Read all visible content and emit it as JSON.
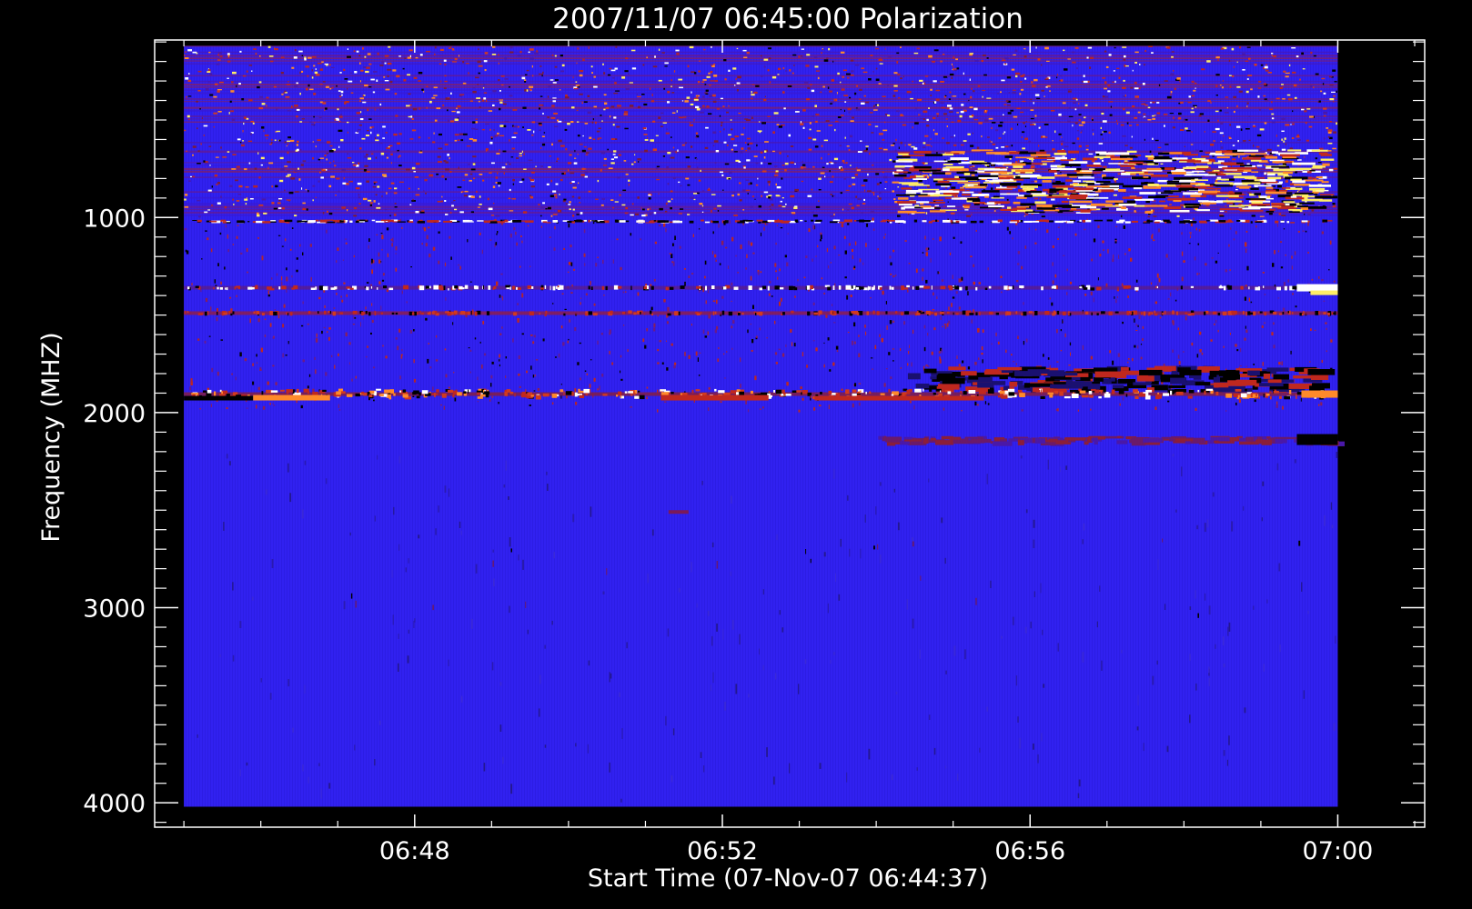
{
  "chart_data": {
    "type": "heatmap",
    "title": "2007/11/07 06:45:00 Polarization",
    "xlabel": "Start Time (07-Nov-07 06:44:37)",
    "ylabel": "Frequency (MHZ)",
    "x_tick_labels": [
      "06:48",
      "06:52",
      "06:56",
      "07:00"
    ],
    "y_tick_labels": [
      "1000",
      "2000",
      "3000",
      "4000"
    ],
    "x_tick_minutes": [
      48,
      52,
      56,
      60
    ],
    "y_tick_values": [
      1000,
      2000,
      3000,
      4000
    ],
    "xlim_minutes": [
      44.62,
      61.13
    ],
    "ylim_mhz": [
      4125,
      90
    ],
    "data_extent": {
      "t_start_minutes": 45.0,
      "t_end_minutes": 60.0,
      "f_min_mhz": 120,
      "f_max_mhz": 4020
    },
    "y_axis_inverted": true,
    "grid": false,
    "legend": "none",
    "colors": {
      "background": "#000000",
      "axes": "#ffffff",
      "base": "#2f20f2",
      "warm": "#c0281e",
      "hot": "#ff8a2a",
      "white": "#ffffff",
      "yellow": "#ffee66"
    },
    "features": [
      {
        "kind": "noisy-band",
        "f_from_mhz": 120,
        "f_to_mhz": 1000,
        "intensity": "high"
      },
      {
        "kind": "speckle-band",
        "f_from_mhz": 1000,
        "f_to_mhz": 2000,
        "intensity": "medium"
      },
      {
        "kind": "bright-line",
        "f_mhz": 1360
      },
      {
        "kind": "red-line",
        "f_mhz": 1490
      },
      {
        "kind": "red-line",
        "f_mhz": 1905
      },
      {
        "kind": "dark-red-band",
        "f_from_mhz": 2120,
        "f_to_mhz": 2200,
        "t_from_minutes": 54.0,
        "t_to_minutes": 60.0
      },
      {
        "kind": "quiet-band",
        "f_from_mhz": 2200,
        "f_to_mhz": 4020
      }
    ]
  }
}
